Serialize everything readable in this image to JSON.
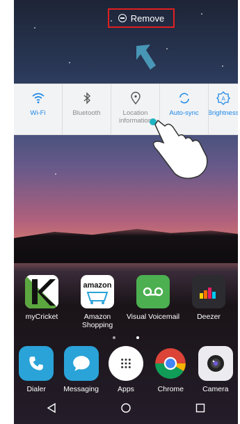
{
  "remove_bar": {
    "label": "Remove"
  },
  "quick_settings": [
    {
      "label": "Wi-Fi",
      "icon": "wifi-icon",
      "active": true
    },
    {
      "label": "Bluetooth",
      "icon": "bluetooth-icon",
      "active": false
    },
    {
      "label": "Location information",
      "icon": "location-icon",
      "active": false
    },
    {
      "label": "Auto-sync",
      "icon": "sync-icon",
      "active": true
    },
    {
      "label": "Brightness",
      "icon": "brightness-icon",
      "active": true
    }
  ],
  "home_apps": [
    {
      "label": "myCricket",
      "icon": "mycricket-icon"
    },
    {
      "label": "Amazon Shopping",
      "icon": "amazon-icon",
      "logo_text": "amazon"
    },
    {
      "label": "Visual Voicemail",
      "icon": "voicemail-icon"
    },
    {
      "label": "Deezer",
      "icon": "deezer-icon"
    }
  ],
  "dock_apps": [
    {
      "label": "Dialer",
      "icon": "phone-icon"
    },
    {
      "label": "Messaging",
      "icon": "messaging-icon"
    },
    {
      "label": "Apps",
      "icon": "apps-grid-icon"
    },
    {
      "label": "Chrome",
      "icon": "chrome-icon"
    },
    {
      "label": "Camera",
      "icon": "camera-icon"
    }
  ],
  "colors": {
    "accent": "#1e88e5",
    "highlight_border": "#e02020"
  }
}
